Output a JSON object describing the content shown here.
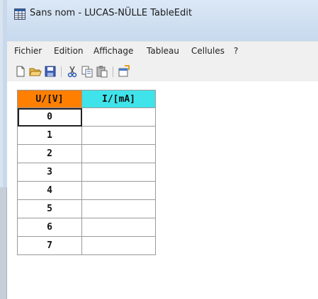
{
  "window": {
    "title": "Sans nom - LUCAS-NÜLLE TableEdit"
  },
  "menu": [
    "Fichier",
    "Edition",
    "Affichage",
    "Tableau",
    "Cellules",
    "?"
  ],
  "toolbar": {
    "icons": [
      "new-file-icon",
      "open-folder-icon",
      "save-icon",
      "cut-icon",
      "copy-icon",
      "paste-icon",
      "properties-icon"
    ]
  },
  "table": {
    "headers": [
      "U/[V]",
      "I/[mA]"
    ],
    "header_colors": [
      "#ff7f00",
      "#3fe3ea"
    ],
    "rows": [
      [
        "0",
        ""
      ],
      [
        "1",
        ""
      ],
      [
        "2",
        ""
      ],
      [
        "3",
        ""
      ],
      [
        "4",
        ""
      ],
      [
        "5",
        ""
      ],
      [
        "6",
        ""
      ],
      [
        "7",
        ""
      ]
    ]
  }
}
